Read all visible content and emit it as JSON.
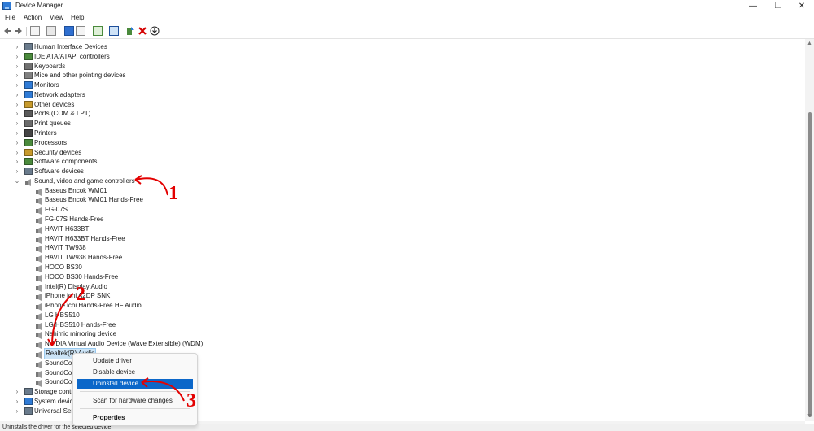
{
  "window": {
    "title": "Device Manager",
    "controls": [
      "—",
      "❐",
      "✕"
    ]
  },
  "menu": [
    "File",
    "Action",
    "View",
    "Help"
  ],
  "tree": [
    {
      "label": "Human Interface Devices",
      "chevron": "›",
      "icon": "hid-icon",
      "color": "#6a7b8c"
    },
    {
      "label": "IDE ATA/ATAPI controllers",
      "chevron": "›",
      "icon": "ide-controller-icon",
      "color": "#4a8a3c"
    },
    {
      "label": "Keyboards",
      "chevron": "›",
      "icon": "keyboard-icon",
      "color": "#707070"
    },
    {
      "label": "Mice and other pointing devices",
      "chevron": "›",
      "icon": "mouse-icon",
      "color": "#808080"
    },
    {
      "label": "Monitors",
      "chevron": "›",
      "icon": "monitor-icon",
      "color": "#2f7bd6"
    },
    {
      "label": "Network adapters",
      "chevron": "›",
      "icon": "network-adapter-icon",
      "color": "#2f7bd6"
    },
    {
      "label": "Other devices",
      "chevron": "›",
      "icon": "other-devices-icon",
      "color": "#c79a2c"
    },
    {
      "label": "Ports (COM & LPT)",
      "chevron": "›",
      "icon": "port-icon",
      "color": "#5a5a5a"
    },
    {
      "label": "Print queues",
      "chevron": "›",
      "icon": "printer-icon",
      "color": "#6a6a6a"
    },
    {
      "label": "Printers",
      "chevron": "›",
      "icon": "printer-icon",
      "color": "#444444"
    },
    {
      "label": "Processors",
      "chevron": "›",
      "icon": "processor-icon",
      "color": "#4a8a3c"
    },
    {
      "label": "Security devices",
      "chevron": "›",
      "icon": "security-device-icon",
      "color": "#c79a2c"
    },
    {
      "label": "Software components",
      "chevron": "›",
      "icon": "software-component-icon",
      "color": "#4a8a3c"
    },
    {
      "label": "Software devices",
      "chevron": "›",
      "icon": "software-device-icon",
      "color": "#6a7b8c"
    },
    {
      "label": "Sound, video and game controllers",
      "chevron": "⌄",
      "icon": "speaker-icon",
      "color": "#808080"
    },
    {
      "label": "Baseus Encok WM01",
      "icon": "speaker-icon",
      "color": "#808080",
      "child": true
    },
    {
      "label": "Baseus Encok WM01 Hands-Free",
      "icon": "speaker-icon",
      "color": "#808080",
      "child": true
    },
    {
      "label": "FG-07S",
      "icon": "speaker-icon",
      "color": "#808080",
      "child": true
    },
    {
      "label": "FG-07S Hands-Free",
      "icon": "speaker-icon",
      "color": "#808080",
      "child": true
    },
    {
      "label": "HAVIT H633BT",
      "icon": "speaker-icon",
      "color": "#808080",
      "child": true
    },
    {
      "label": "HAVIT H633BT Hands-Free",
      "icon": "speaker-icon",
      "color": "#808080",
      "child": true
    },
    {
      "label": "HAVIT TW938",
      "icon": "speaker-icon",
      "color": "#808080",
      "child": true
    },
    {
      "label": "HAVIT TW938 Hands-Free",
      "icon": "speaker-icon",
      "color": "#808080",
      "child": true
    },
    {
      "label": "HOCO BS30",
      "icon": "speaker-icon",
      "color": "#808080",
      "child": true
    },
    {
      "label": "HOCO BS30 Hands-Free",
      "icon": "speaker-icon",
      "color": "#808080",
      "child": true
    },
    {
      "label": "Intel(R) Display Audio",
      "icon": "speaker-icon",
      "color": "#808080",
      "child": true
    },
    {
      "label": "iPhone ichi A2DP SNK",
      "icon": "speaker-icon",
      "color": "#808080",
      "child": true
    },
    {
      "label": "iPhone ichi Hands-Free HF Audio",
      "icon": "speaker-icon",
      "color": "#808080",
      "child": true
    },
    {
      "label": "LG HBS510",
      "icon": "speaker-icon",
      "color": "#808080",
      "child": true
    },
    {
      "label": "LG HBS510 Hands-Free",
      "icon": "speaker-icon",
      "color": "#808080",
      "child": true
    },
    {
      "label": "Nahimic mirroring device",
      "icon": "speaker-icon",
      "color": "#808080",
      "child": true
    },
    {
      "label": "NVIDIA Virtual Audio Device (Wave Extensible) (WDM)",
      "icon": "speaker-icon",
      "color": "#808080",
      "child": true
    },
    {
      "label": "Realtek(R) Audio",
      "icon": "speaker-icon",
      "color": "#808080",
      "child": true,
      "selected": true
    },
    {
      "label": "SoundCore",
      "icon": "speaker-icon",
      "color": "#808080",
      "child": true
    },
    {
      "label": "SoundCore",
      "icon": "speaker-icon",
      "color": "#808080",
      "child": true
    },
    {
      "label": "SoundCore",
      "icon": "speaker-icon",
      "color": "#808080",
      "child": true
    },
    {
      "label": "Storage controllers",
      "chevron": "›",
      "icon": "storage-controller-icon",
      "color": "#6a7b8c"
    },
    {
      "label": "System devices",
      "chevron": "›",
      "icon": "system-device-icon",
      "color": "#2f7bd6"
    },
    {
      "label": "Universal Serial Bus controllers",
      "chevron": "›",
      "icon": "usb-controller-icon",
      "color": "#6a7b8c"
    }
  ],
  "context_menu": {
    "items": [
      "Update driver",
      "Disable device",
      "Uninstall device",
      "Scan for hardware changes",
      "Properties"
    ],
    "highlighted": "Uninstall device"
  },
  "callouts": [
    "1",
    "2",
    "3"
  ],
  "status": "Uninstalls the driver for the selected device."
}
